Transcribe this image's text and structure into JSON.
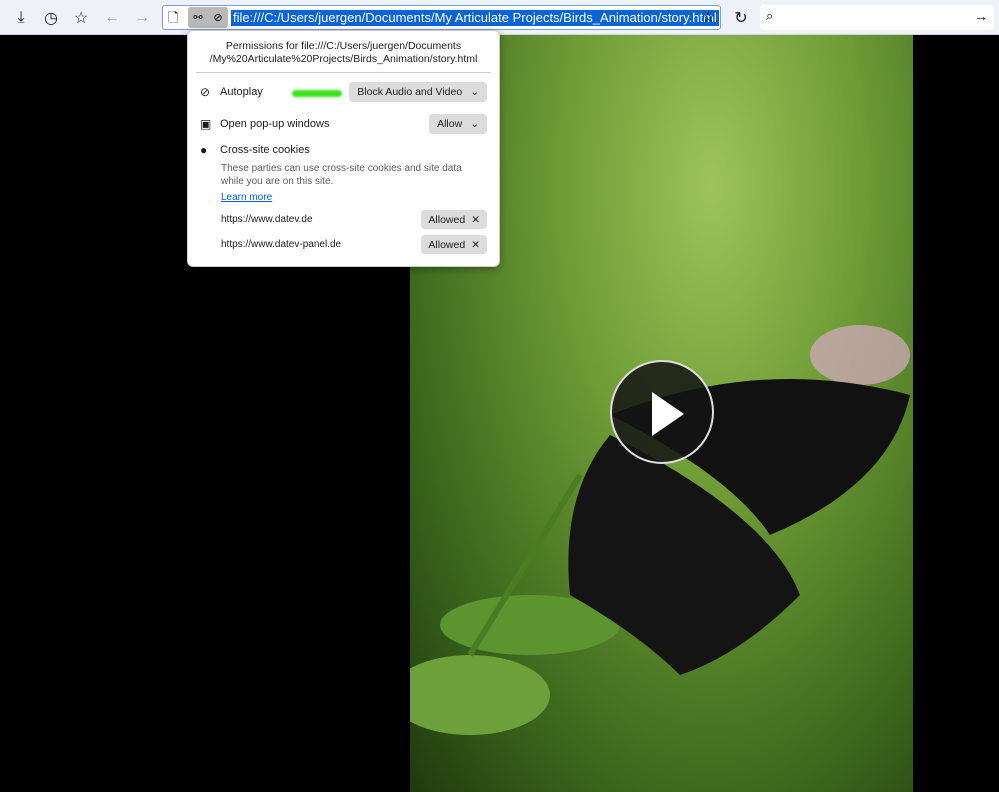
{
  "toolbar": {
    "url": "file:///C:/Users/juergen/Documents/My Articulate Projects/Birds_Animation/story.html",
    "search_placeholder": ""
  },
  "popup": {
    "title_line1": "Permissions for file:///C:/Users/juergen/Documents",
    "title_line2": "/My%20Articulate%20Projects/Birds_Animation/story.html",
    "autoplay_label": "Autoplay",
    "autoplay_value": "Block Audio and Video",
    "popups_label": "Open pop-up windows",
    "popups_value": "Allow",
    "cookies_label": "Cross-site cookies",
    "cookies_desc": "These parties can use cross-site cookies and site data while you are on this site.",
    "learn_more": "Learn more",
    "sites": [
      {
        "url": "https://www.datev.de",
        "status": "Allowed"
      },
      {
        "url": "https://www.datev-panel.de",
        "status": "Allowed"
      }
    ]
  }
}
